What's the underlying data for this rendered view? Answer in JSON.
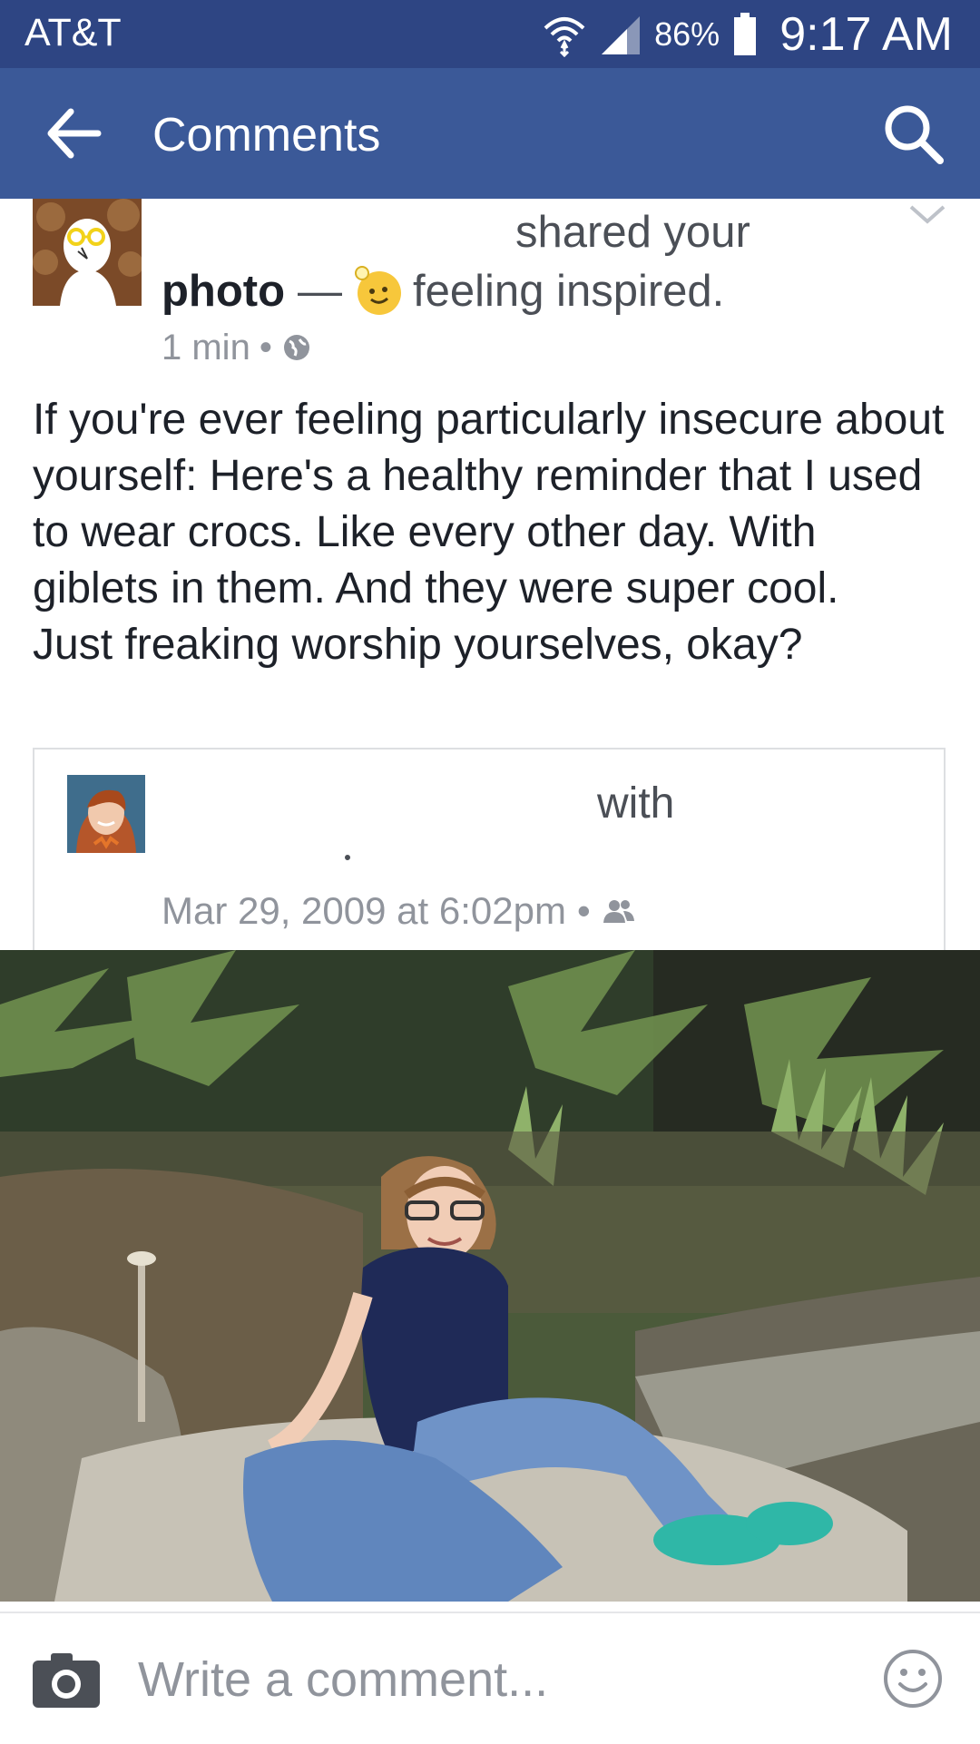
{
  "status_bar": {
    "carrier": "AT&T",
    "battery": "86%",
    "time": "9:17 AM",
    "icons": [
      "wifi-icon",
      "signal-icon",
      "battery-icon"
    ]
  },
  "app_bar": {
    "title": "Comments",
    "back_icon": "arrow-left-icon",
    "search_icon": "search-icon",
    "background": "#3b5998"
  },
  "post": {
    "shared_text": "shared your",
    "photo_link": "photo",
    "dash": "—",
    "feeling": "feeling inspired.",
    "time": "1 min",
    "separator": "•",
    "privacy_icon": "globe-icon",
    "text": "If you're ever feeling particularly insecure about yourself: Here's a healthy reminder that I used to wear crocs. Like every other day. With giblets in them. And they were super cool.\nJust freaking worship yourselves, okay?"
  },
  "shared_card": {
    "with_text": "with",
    "dot": ".",
    "date": "Mar 29, 2009 at 6:02pm",
    "separator": "•",
    "audience_icon": "friends-icon"
  },
  "composer": {
    "placeholder": "Write a comment...",
    "camera_icon": "camera-icon",
    "emoji_icon": "smiley-icon"
  },
  "colors": {
    "status_bar": "#2e4583",
    "app_bar": "#3b5998",
    "secondary_text": "#90949c"
  }
}
